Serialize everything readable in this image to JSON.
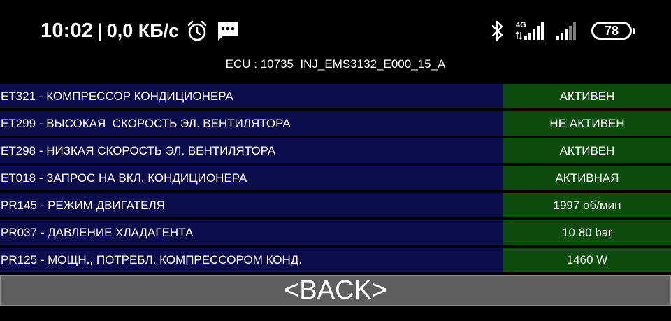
{
  "status_bar": {
    "time": "10:02",
    "separator": "|",
    "speed": "0,0 КБ/с",
    "network_type": "4G",
    "battery": "78",
    "icons": [
      "alarm-clock-icon",
      "message-icon",
      "bluetooth-icon",
      "signal-4g-icon",
      "signal-icon",
      "battery-icon"
    ]
  },
  "header": {
    "ecu": "ECU : 10735  INJ_EMS3132_E000_15_A"
  },
  "rows": [
    {
      "label": "ET321 - КОМПРЕССОР КОНДИЦИОНЕРА",
      "value": "АКТИВЕН"
    },
    {
      "label": "ET299 - ВЫСОКАЯ  СКОРОСТЬ ЭЛ. ВЕНТИЛЯТОРА",
      "value": "НЕ АКТИВЕН"
    },
    {
      "label": "ET298 - НИЗКАЯ СКОРОСТЬ ЭЛ. ВЕНТИЛЯТОРА",
      "value": "АКТИВЕН"
    },
    {
      "label": "ET018 - ЗАПРОС НА ВКЛ. КОНДИЦИОНЕРА",
      "value": "АКТИВНАЯ"
    },
    {
      "label": "PR145 - РЕЖИМ ДВИГАТЕЛЯ",
      "value": "1997 об/мин"
    },
    {
      "label": "PR037 - ДАВЛЕНИЕ ХЛАДАГЕНТА",
      "value": "10.80 bar"
    },
    {
      "label": "PR125 - МОЩН., ПОТРЕБЛ. КОМПРЕССОРОМ КОНД.",
      "value": "1460 W"
    }
  ],
  "back_button": {
    "label": "<BACK>"
  },
  "colors": {
    "label_bg": "#0d0d4e",
    "value_bg": "#0c4c0c",
    "button_bg": "#5e5e5e"
  }
}
